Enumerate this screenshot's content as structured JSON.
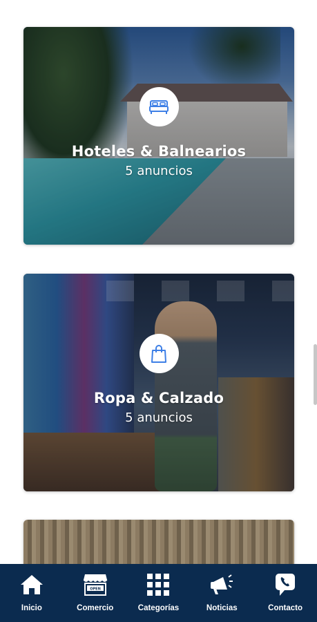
{
  "categories": [
    {
      "title": "Hoteles & Balnearios",
      "count": "5 anuncios",
      "icon": "bed-icon"
    },
    {
      "title": "Ropa & Calzado",
      "count": "5 anuncios",
      "icon": "shopping-bag-icon"
    }
  ],
  "nav": {
    "items": [
      {
        "label": "Inicio",
        "icon": "home-icon"
      },
      {
        "label": "Comercio",
        "icon": "store-icon"
      },
      {
        "label": "Categorías",
        "icon": "grid-icon"
      },
      {
        "label": "Noticias",
        "icon": "megaphone-icon"
      },
      {
        "label": "Contacto",
        "icon": "phone-chat-icon"
      }
    ]
  },
  "colors": {
    "nav_background": "#0b2b4f",
    "accent_blue": "#3d7fe6",
    "card_text": "#ffffff"
  }
}
